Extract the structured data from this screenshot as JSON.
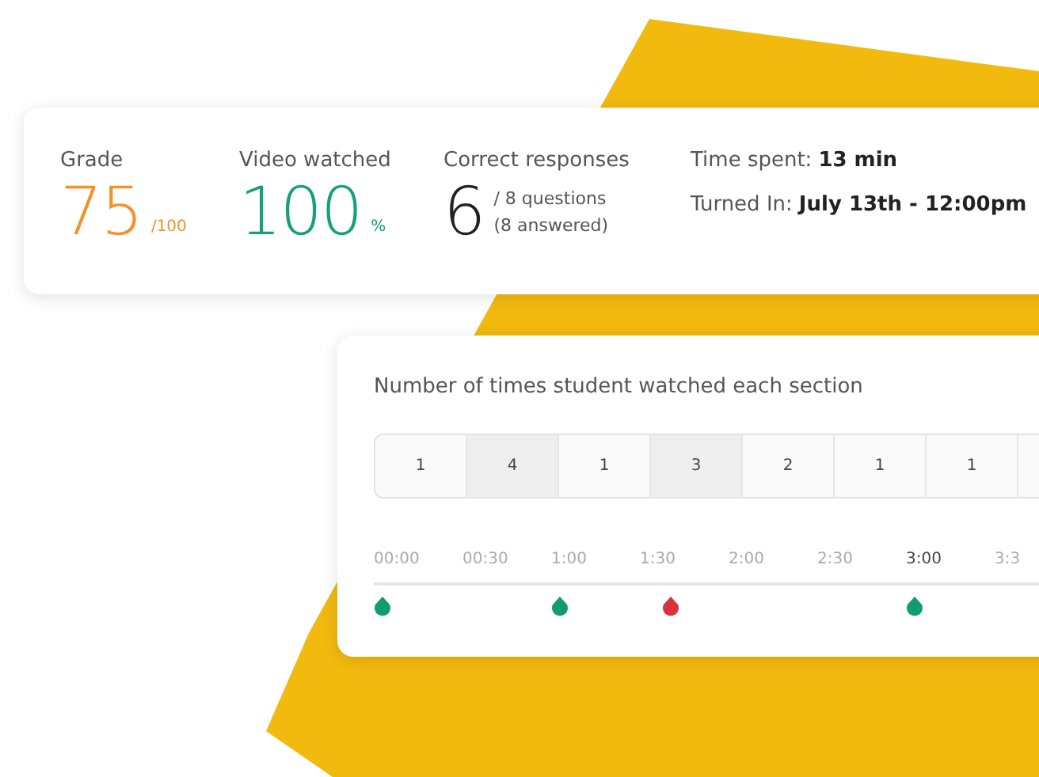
{
  "summary": {
    "grade": {
      "label": "Grade",
      "value": "75",
      "suffix": "/100"
    },
    "video": {
      "label": "Video watched",
      "value": "100",
      "suffix": "%"
    },
    "responses": {
      "label": "Correct responses",
      "value": "6",
      "detail_1": "/ 8 questions",
      "detail_2": "(8 answered)"
    },
    "time_spent": {
      "label": "Time spent:",
      "value": "13 min"
    },
    "turned_in": {
      "label": "Turned In:",
      "value": "July 13th - 12:00pm"
    }
  },
  "sections": {
    "title": "Number of times student watched each section",
    "cells": [
      {
        "count": "1",
        "shaded": false
      },
      {
        "count": "4",
        "shaded": true
      },
      {
        "count": "1",
        "shaded": false
      },
      {
        "count": "3",
        "shaded": true
      },
      {
        "count": "2",
        "shaded": false
      },
      {
        "count": "1",
        "shaded": false
      },
      {
        "count": "1",
        "shaded": false
      },
      {
        "shaded": false
      }
    ],
    "ticks": [
      {
        "label": "00:00",
        "current": false,
        "color": "#109b73"
      },
      {
        "label": "00:30",
        "current": false
      },
      {
        "label": "1:00",
        "current": false,
        "color": "#109b73"
      },
      {
        "label": "1:30",
        "current": false,
        "color": "#d9323c"
      },
      {
        "label": "2:00",
        "current": false
      },
      {
        "label": "2:30",
        "current": false
      },
      {
        "label": "3:00",
        "current": true,
        "color": "#109b73"
      },
      {
        "label": "3:3",
        "current": false
      }
    ]
  }
}
